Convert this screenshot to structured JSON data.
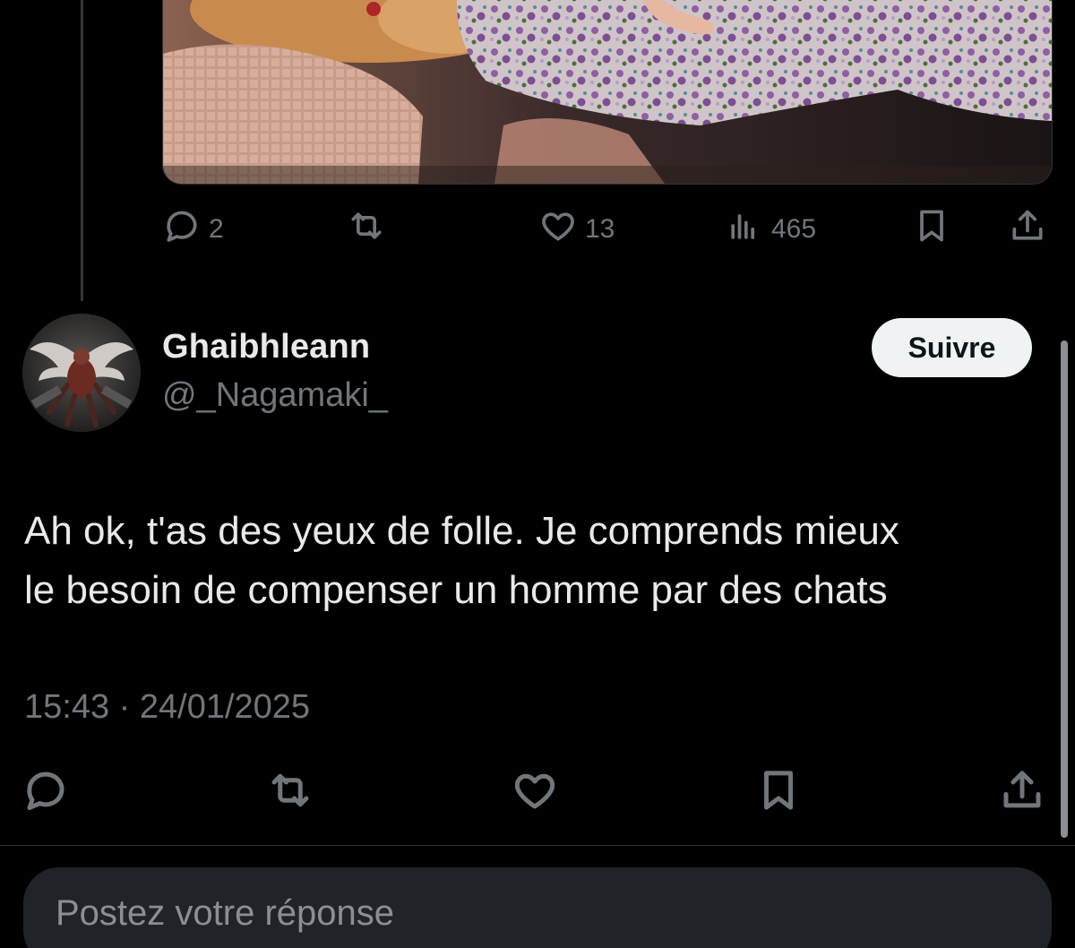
{
  "previous_tweet": {
    "reply_count": "2",
    "like_count": "13",
    "view_count": "465"
  },
  "tweet": {
    "author_name": "Ghaibhleann",
    "author_handle": "@_Nagamaki_",
    "follow_label": "Suivre",
    "text_lines": [
      "Ah ok, t'as des yeux de folle. Je comprends mieux",
      "le besoin de compenser un homme par des chats"
    ],
    "timestamp": "15:43 · 24/01/2025"
  },
  "reply": {
    "placeholder": "Postez votre réponse"
  },
  "icons": {
    "reply": "reply-icon",
    "retweet": "retweet-icon",
    "like": "heart-icon",
    "views": "views-icon",
    "bookmark": "bookmark-icon",
    "share": "share-icon"
  },
  "colors": {
    "background": "#000000",
    "text_primary": "#e7e9ea",
    "text_secondary": "#71767b",
    "follow_button_bg": "#eff3f4",
    "reply_box_bg": "#202327"
  }
}
